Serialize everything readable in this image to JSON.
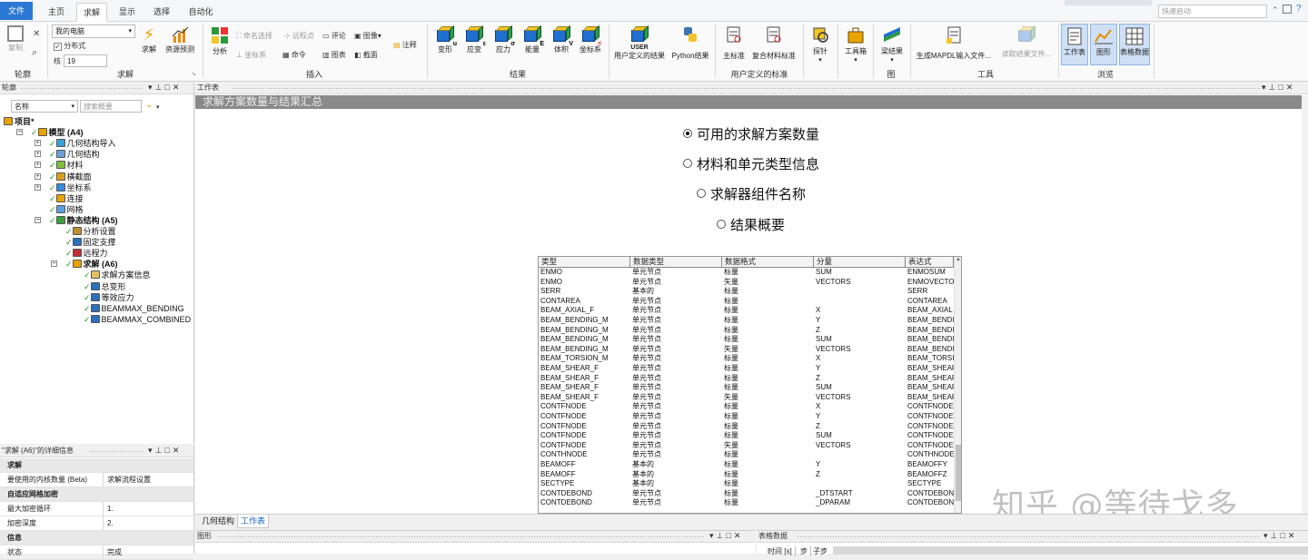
{
  "tabs": [
    "文件",
    "主页",
    "求解",
    "显示",
    "选择",
    "自动化"
  ],
  "active_tab": "求解",
  "quick_launch_placeholder": "快速启动",
  "ribbon": {
    "outline_group": {
      "label": "轮廓",
      "copy": "复制",
      "close": "✕",
      "search": "⌕"
    },
    "solve_group": {
      "label": "求解",
      "solve_target": "我的电脑",
      "distributed": "分布式",
      "cores_label": "核",
      "cores_value": "19",
      "solve": "求解",
      "resource_predict": "资源预测"
    },
    "insert_group": {
      "label": "插入",
      "analysis": "分析",
      "named_selection": "命名选择",
      "remote_point": "远程点",
      "comment": "评论",
      "image": "图像",
      "annotation": "注释",
      "coordinate_system": "坐标系",
      "command": "命令",
      "chart": "图表",
      "section": "截面"
    },
    "results_group": {
      "label": "结果",
      "buttons": [
        {
          "label": "变形",
          "sub": "u"
        },
        {
          "label": "应变",
          "sub": "ε"
        },
        {
          "label": "应力",
          "sub": "σ"
        },
        {
          "label": "能量",
          "sub": "E"
        },
        {
          "label": "体积",
          "sub": "V"
        },
        {
          "label": "坐标系",
          "sub": "✕"
        }
      ]
    },
    "user_results": {
      "label": "用户定义的结果",
      "badge": "USER"
    },
    "python_results": {
      "label": "Python结果"
    },
    "user_criteria_group": {
      "label": "用户定义的标准",
      "primary": "主标准",
      "composite": "复合材料标准"
    },
    "probe": {
      "label": "探针"
    },
    "toolbox": {
      "label": "工具箱"
    },
    "beam": {
      "label": "梁结果"
    },
    "figure_group": {
      "label": "图"
    },
    "tools_group": {
      "label": "工具",
      "mapdl": "生成MAPDL输入文件...",
      "read_results": "读取结果文件..."
    },
    "browse_group": {
      "label": "浏览",
      "worksheet": "工作表",
      "graph": "图形",
      "table_data": "表格数据"
    }
  },
  "outline": {
    "title": "轮廓",
    "filter_label": "名称",
    "search_placeholder": "搜索概要",
    "tree": [
      {
        "label": "项目*",
        "level": 0,
        "bold": true,
        "icon": "project-icon"
      },
      {
        "label": "模型 (A4)",
        "level": 1,
        "bold": true,
        "icon": "model-icon"
      },
      {
        "label": "几何结构导入",
        "level": 2,
        "bold": false,
        "icon": "geometry-import-icon"
      },
      {
        "label": "几何结构",
        "level": 2,
        "bold": false,
        "icon": "geometry-icon"
      },
      {
        "label": "材料",
        "level": 2,
        "bold": false,
        "icon": "materials-icon"
      },
      {
        "label": "横截面",
        "level": 2,
        "bold": false,
        "icon": "cross-section-icon"
      },
      {
        "label": "坐标系",
        "level": 2,
        "bold": false,
        "icon": "coordinate-system-icon"
      },
      {
        "label": "连接",
        "level": 2,
        "bold": false,
        "icon": "connections-icon"
      },
      {
        "label": "网格",
        "level": 2,
        "bold": false,
        "icon": "mesh-icon"
      },
      {
        "label": "静态结构 (A5)",
        "level": 2,
        "bold": true,
        "icon": "static-structural-icon"
      },
      {
        "label": "分析设置",
        "level": 3,
        "bold": false,
        "icon": "analysis-settings-icon"
      },
      {
        "label": "固定支撑",
        "level": 3,
        "bold": false,
        "icon": "fixed-support-icon"
      },
      {
        "label": "远程力",
        "level": 3,
        "bold": false,
        "icon": "remote-force-icon"
      },
      {
        "label": "求解 (A6)",
        "level": 3,
        "bold": true,
        "icon": "solution-icon"
      },
      {
        "label": "求解方案信息",
        "level": 4,
        "bold": false,
        "icon": "solution-info-icon"
      },
      {
        "label": "总变形",
        "level": 4,
        "bold": false,
        "icon": "total-deformation-icon"
      },
      {
        "label": "等效应力",
        "level": 4,
        "bold": false,
        "icon": "equivalent-stress-icon"
      },
      {
        "label": "BEAMMAX_BENDING",
        "level": 4,
        "bold": false,
        "icon": "user-result-icon"
      },
      {
        "label": "BEAMMAX_COMBINED",
        "level": 4,
        "bold": false,
        "icon": "user-result-icon"
      }
    ]
  },
  "details": {
    "title": "\"求解 (A6)\"的详细信息",
    "rows": [
      {
        "type": "section",
        "k": "求解",
        "v": ""
      },
      {
        "type": "row",
        "k": "要使用的内核数量 (Beta)",
        "v": "求解流程设置"
      },
      {
        "type": "section",
        "k": "自适应网格加密",
        "v": ""
      },
      {
        "type": "row",
        "k": "最大加密循环",
        "v": "1."
      },
      {
        "type": "row",
        "k": "加密深度",
        "v": "2."
      },
      {
        "type": "section",
        "k": "信息",
        "v": ""
      },
      {
        "type": "row",
        "k": "状态",
        "v": "完成"
      }
    ]
  },
  "worksheet": {
    "title": "工作表",
    "banner": "求解方案数量与结果汇总",
    "options": [
      {
        "label": "可用的求解方案数量",
        "selected": true
      },
      {
        "label": "材料和单元类型信息",
        "selected": false
      },
      {
        "label": "求解器组件名称",
        "selected": false
      },
      {
        "label": "结果概要",
        "selected": false
      }
    ],
    "table": {
      "columns": [
        "类型",
        "数据类型",
        "数据格式",
        "分量",
        "表达式"
      ],
      "rows": [
        [
          "ENMO",
          "单元节点",
          "标量",
          "SUM",
          "ENMOSUM"
        ],
        [
          "ENMO",
          "单元节点",
          "矢量",
          "VECTORS",
          "ENMOVECTO"
        ],
        [
          "SERR",
          "基本的",
          "标量",
          "",
          "SERR"
        ],
        [
          "CONTAREA",
          "单元节点",
          "标量",
          "",
          "CONTAREA"
        ],
        [
          "BEAM_AXIAL_F",
          "单元节点",
          "标量",
          "X",
          "BEAM_AXIAL"
        ],
        [
          "BEAM_BENDING_M",
          "单元节点",
          "标量",
          "Y",
          "BEAM_BENDI"
        ],
        [
          "BEAM_BENDING_M",
          "单元节点",
          "标量",
          "Z",
          "BEAM_BENDI"
        ],
        [
          "BEAM_BENDING_M",
          "单元节点",
          "标量",
          "SUM",
          "BEAM_BENDI"
        ],
        [
          "BEAM_BENDING_M",
          "单元节点",
          "矢量",
          "VECTORS",
          "BEAM_BENDI"
        ],
        [
          "BEAM_TORSION_M",
          "单元节点",
          "标量",
          "X",
          "BEAM_TORSI"
        ],
        [
          "BEAM_SHEAR_F",
          "单元节点",
          "标量",
          "Y",
          "BEAM_SHEAF"
        ],
        [
          "BEAM_SHEAR_F",
          "单元节点",
          "标量",
          "Z",
          "BEAM_SHEAF"
        ],
        [
          "BEAM_SHEAR_F",
          "单元节点",
          "标量",
          "SUM",
          "BEAM_SHEAF"
        ],
        [
          "BEAM_SHEAR_F",
          "单元节点",
          "矢量",
          "VECTORS",
          "BEAM_SHEAF"
        ],
        [
          "CONTFNODE",
          "单元节点",
          "标量",
          "X",
          "CONTFNODE"
        ],
        [
          "CONTFNODE",
          "单元节点",
          "标量",
          "Y",
          "CONTFNODE"
        ],
        [
          "CONTFNODE",
          "单元节点",
          "标量",
          "Z",
          "CONTFNODE"
        ],
        [
          "CONTFNODE",
          "单元节点",
          "标量",
          "SUM",
          "CONTFNODE"
        ],
        [
          "CONTFNODE",
          "单元节点",
          "矢量",
          "VECTORS",
          "CONTFNODE"
        ],
        [
          "CONTHNODE",
          "单元节点",
          "标量",
          "",
          "CONTHNODE"
        ],
        [
          "BEAMOFF",
          "基本的",
          "标量",
          "Y",
          "BEAMOFFY"
        ],
        [
          "BEAMOFF",
          "基本的",
          "标量",
          "Z",
          "BEAMOFFZ"
        ],
        [
          "SECTYPE",
          "基本的",
          "标量",
          "",
          "SECTYPE"
        ],
        [
          "CONTDEBOND",
          "单元节点",
          "标量",
          "_DTSTART",
          "CONTDEBON"
        ],
        [
          "CONTDEBOND",
          "单元节点",
          "标量",
          "_DPARAM",
          "CONTDEBON"
        ]
      ]
    }
  },
  "bottom_tabs": [
    "几何结构",
    "工作表"
  ],
  "active_bottom_tab": "工作表",
  "graph_pane": {
    "title": "图形"
  },
  "tabdata_pane": {
    "title": "表格数据",
    "cols": [
      "时间 [s]",
      "步",
      "子步"
    ]
  },
  "watermark": "知乎 @等待戈多",
  "colors": {
    "file_tab": "#2b78d4",
    "accent": "#1a62c0"
  }
}
